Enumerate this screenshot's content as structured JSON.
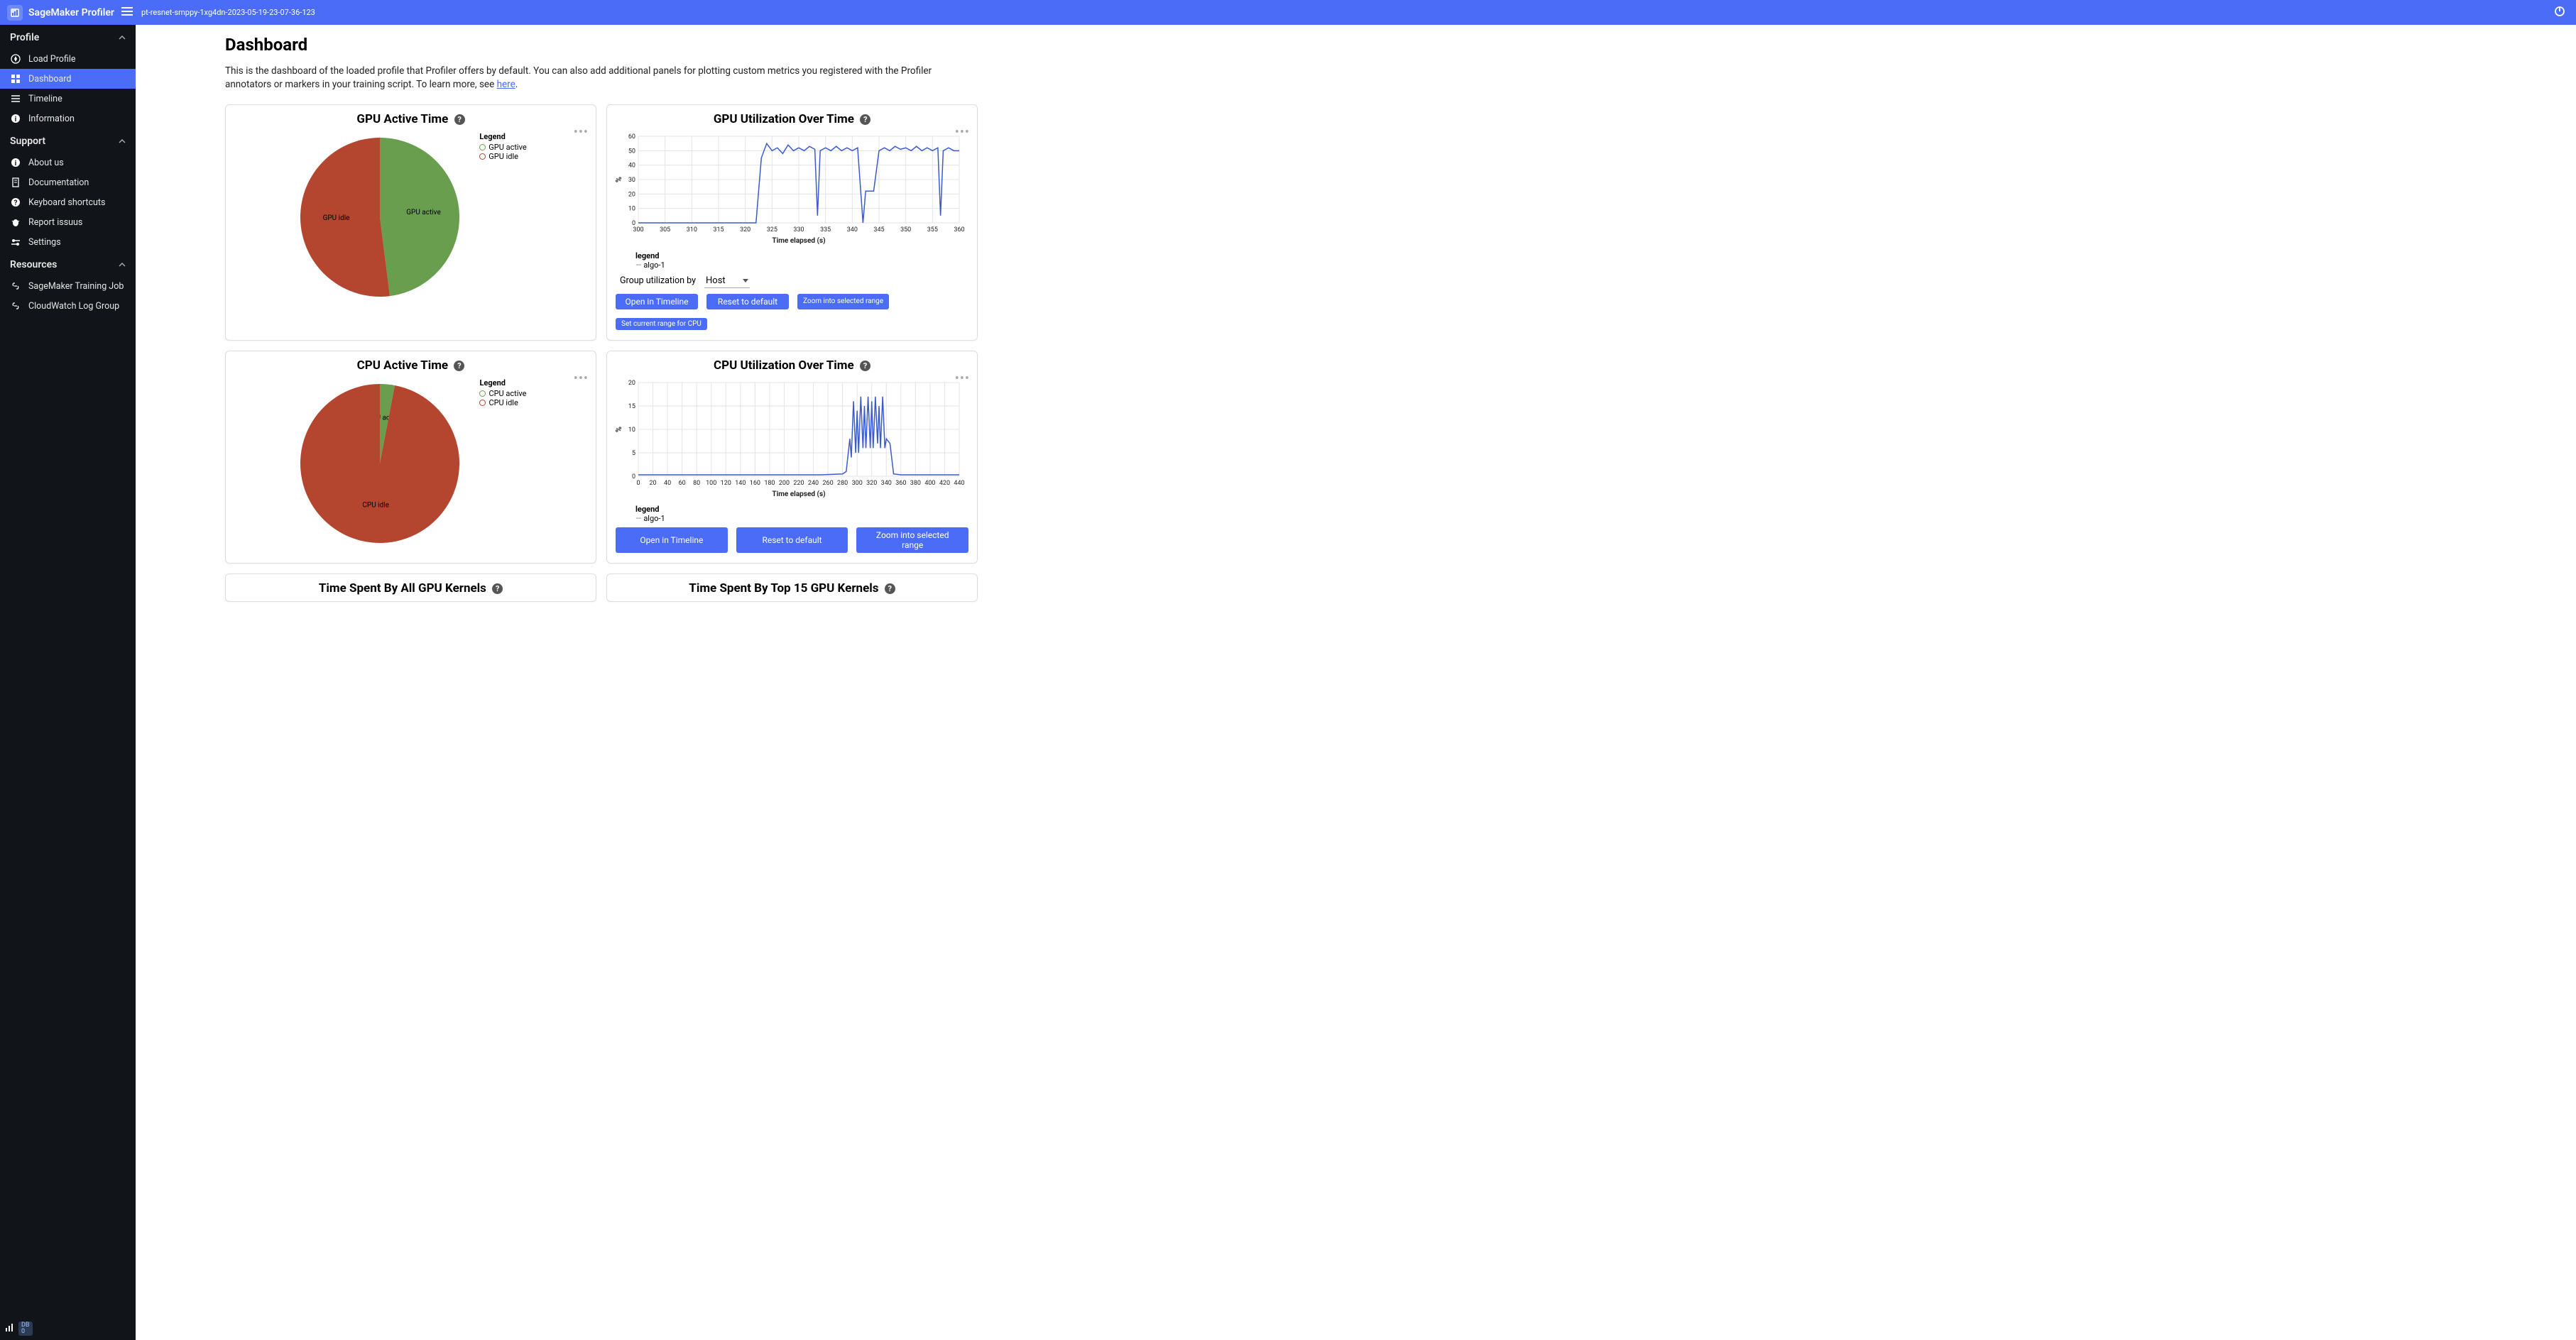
{
  "header": {
    "brand": "SageMaker Profiler",
    "job_name": "pt-resnet-smppy-1xg4dn-2023-05-19-23-07-36-123"
  },
  "sidebar": {
    "sections": {
      "profile": "Profile",
      "support": "Support",
      "resources": "Resources"
    },
    "profile_items": [
      {
        "label": "Load Profile"
      },
      {
        "label": "Dashboard",
        "active": true
      },
      {
        "label": "Timeline"
      },
      {
        "label": "Information"
      }
    ],
    "support_items": [
      {
        "label": "About us"
      },
      {
        "label": "Documentation"
      },
      {
        "label": "Keyboard shortcuts"
      },
      {
        "label": "Report issuus"
      },
      {
        "label": "Settings"
      }
    ],
    "resources_items": [
      {
        "label": "SageMaker Training Job"
      },
      {
        "label": "CloudWatch Log Group"
      }
    ],
    "badge_top": "DB",
    "badge_bottom": "0"
  },
  "page": {
    "title": "Dashboard",
    "intro_pre": "This is the dashboard of the loaded profile that Profiler offers by default. You can also add additional panels for plotting custom metrics you registered with the Profiler annotators or markers in your training script. To learn more, see ",
    "intro_link": "here",
    "intro_post": "."
  },
  "panels": {
    "gpu_active": {
      "title": "GPU Active Time",
      "legend_header": "Legend",
      "items": [
        "GPU active",
        "GPU idle"
      ],
      "label_active": "GPU active",
      "label_idle": "GPU idle"
    },
    "gpu_util": {
      "title": "GPU Utilization Over Time",
      "ylabel": "%",
      "xlabel": "Time elapsed (s)",
      "legend_header": "legend",
      "series_name": "algo-1",
      "group_label": "Group utilization by",
      "group_value": "Host",
      "buttons": [
        "Open in Timeline",
        "Reset to default",
        "Zoom into selected range",
        "Set current range for CPU"
      ]
    },
    "cpu_active": {
      "title": "CPU Active Time",
      "legend_header": "Legend",
      "items": [
        "CPU active",
        "CPU idle"
      ],
      "label_active": "CPU active",
      "label_idle": "CPU idle"
    },
    "cpu_util": {
      "title": "CPU Utilization Over Time",
      "ylabel": "%",
      "xlabel": "Time elapsed (s)",
      "legend_header": "legend",
      "series_name": "algo-1",
      "buttons": [
        "Open in Timeline",
        "Reset to default",
        "Zoom into selected range"
      ]
    },
    "gpu_kernels_all": {
      "title": "Time Spent By All GPU Kernels"
    },
    "gpu_kernels_top": {
      "title": "Time Spent By Top 15 GPU Kernels"
    }
  },
  "chart_data": [
    {
      "type": "pie",
      "title": "GPU Active Time",
      "series": [
        {
          "name": "GPU active",
          "value": 48,
          "color": "#6a9e4f"
        },
        {
          "name": "GPU idle",
          "value": 52,
          "color": "#b4452f"
        }
      ]
    },
    {
      "type": "line",
      "title": "GPU Utilization Over Time",
      "xlabel": "Time elapsed (s)",
      "ylabel": "%",
      "xlim": [
        300,
        360
      ],
      "ylim": [
        0,
        60
      ],
      "x_ticks": [
        300,
        305,
        310,
        315,
        320,
        325,
        330,
        335,
        340,
        345,
        350,
        355,
        360
      ],
      "y_ticks": [
        0,
        10,
        20,
        30,
        40,
        50,
        60
      ],
      "series": [
        {
          "name": "algo-1",
          "color": "#3b5bcc",
          "x": [
            300,
            305,
            310,
            315,
            320,
            322,
            323,
            324,
            325,
            326,
            327,
            328,
            329,
            330,
            331,
            332,
            333,
            333.5,
            334,
            335,
            336,
            337,
            338,
            339,
            340,
            341,
            342,
            342.5,
            343,
            344,
            345,
            346,
            347,
            348,
            349,
            350,
            351,
            352,
            353,
            354,
            355,
            356,
            356.5,
            357,
            358,
            359,
            360
          ],
          "y": [
            0,
            0,
            0,
            0,
            0,
            0,
            45,
            55,
            50,
            52,
            48,
            54,
            50,
            52,
            50,
            53,
            51,
            5,
            50,
            52,
            50,
            53,
            50,
            52,
            50,
            52,
            0,
            22,
            22,
            22,
            50,
            52,
            50,
            53,
            51,
            52,
            50,
            53,
            50,
            52,
            50,
            52,
            5,
            50,
            52,
            50,
            50
          ]
        }
      ]
    },
    {
      "type": "pie",
      "title": "CPU Active Time",
      "series": [
        {
          "name": "CPU active",
          "value": 3,
          "color": "#6a9e4f"
        },
        {
          "name": "CPU idle",
          "value": 97,
          "color": "#b4452f"
        }
      ]
    },
    {
      "type": "line",
      "title": "CPU Utilization Over Time",
      "xlabel": "Time elapsed (s)",
      "ylabel": "%",
      "xlim": [
        0,
        440
      ],
      "ylim": [
        0,
        20
      ],
      "x_ticks": [
        0,
        20,
        40,
        60,
        80,
        100,
        120,
        140,
        160,
        180,
        200,
        220,
        240,
        260,
        280,
        300,
        320,
        340,
        360,
        380,
        400,
        420,
        440
      ],
      "y_ticks": [
        0,
        5,
        10,
        15,
        20
      ],
      "series": [
        {
          "name": "algo-1",
          "color": "#3b5bcc",
          "x": [
            0,
            50,
            100,
            150,
            200,
            250,
            280,
            285,
            290,
            292,
            295,
            298,
            300,
            302,
            305,
            308,
            310,
            312,
            315,
            318,
            320,
            322,
            325,
            328,
            330,
            332,
            335,
            338,
            340,
            345,
            350,
            360,
            380,
            400,
            440
          ],
          "y": [
            0.3,
            0.3,
            0.3,
            0.3,
            0.3,
            0.3,
            0.5,
            1,
            8,
            4,
            16,
            5,
            14,
            5,
            17,
            6,
            15,
            6,
            17,
            6,
            16,
            6,
            17,
            7,
            15,
            6,
            17,
            6,
            8,
            7,
            0.5,
            0.3,
            0.3,
            0.3,
            0.3
          ]
        }
      ]
    }
  ]
}
